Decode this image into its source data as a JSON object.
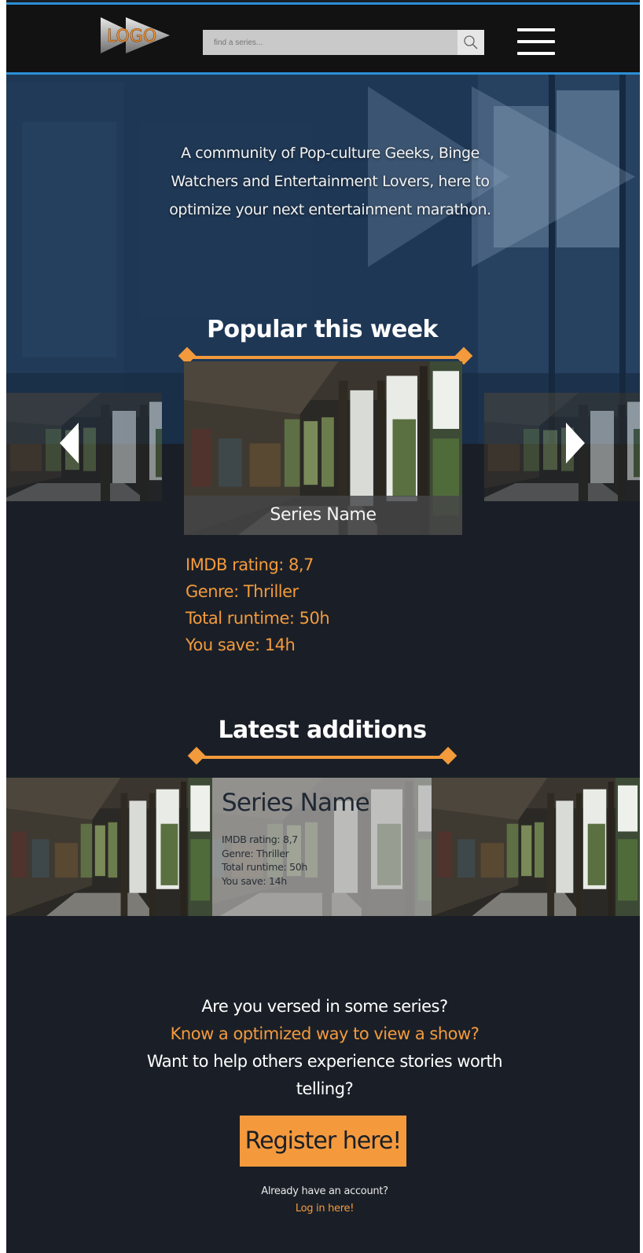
{
  "header": {
    "logo_text": "LOGO",
    "search_placeholder": "find a series...",
    "search_icon": "search-icon",
    "menu_icon": "hamburger-menu-icon"
  },
  "hero": {
    "tagline": "A community of Pop-culture Geeks, Binge Watchers and Entertainment Lovers, here to optimize your next entertainment marathon."
  },
  "popular": {
    "title": "Popular this week",
    "card": {
      "series_name": "Series Name",
      "imdb": "IMDB rating: 8,7",
      "genre": "Genre: Thriller",
      "runtime": "Total runtime: 50h",
      "save": "You save: 14h"
    },
    "prev_icon": "chevron-left-icon",
    "next_icon": "chevron-right-icon"
  },
  "latest": {
    "title": "Latest additions",
    "card": {
      "series_name": "Series Name",
      "imdb": "IMDB rating: 8,7",
      "genre": "Genre: Thriller",
      "runtime": "Total runtime: 50h",
      "save": "You save: 14h"
    }
  },
  "cta": {
    "line1": "Are you versed in some series?",
    "line2": "Know a optimized way to view a show?",
    "line3": "Want to help others experience stories worth telling?",
    "register_label": "Register here!",
    "account_text": "Already have an account?",
    "login_label": "Log in here!"
  },
  "colors": {
    "accent": "#f39a3c",
    "header_border": "#2b8fd6",
    "background": "#1a1f27"
  }
}
